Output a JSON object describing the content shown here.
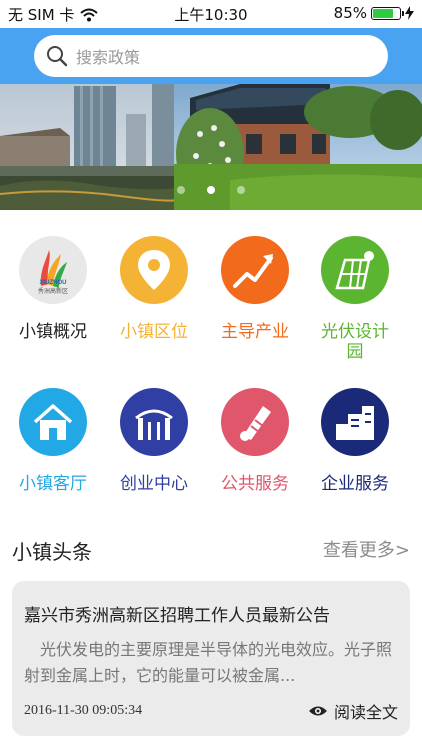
{
  "status_bar": {
    "carrier": "无 SIM 卡",
    "time": "上午10:30",
    "battery_percent": "85%",
    "battery_level": 0.85
  },
  "search": {
    "placeholder": "搜索政策"
  },
  "banner": {
    "slide_count": 3,
    "active_slide": 1
  },
  "logo": {
    "text_top": "XIUZHOU",
    "text_bottom": "秀洲高新区"
  },
  "grid": [
    {
      "label": "小镇概况",
      "color": "#222222",
      "icon": "logo-icon"
    },
    {
      "label": "小镇区位",
      "color": "#f5b335",
      "icon": "location-pin-icon"
    },
    {
      "label": "主导产业",
      "color": "#f26a1b",
      "icon": "trend-chart-icon"
    },
    {
      "label": "光伏设计园",
      "color": "#5cb531",
      "icon": "solar-panel-icon"
    },
    {
      "label": "小镇客厅",
      "color": "#23a8e6",
      "icon": "house-icon"
    },
    {
      "label": "创业中心",
      "color": "#2f3fa3",
      "icon": "gate-icon"
    },
    {
      "label": "公共服务",
      "color": "#e0566b",
      "icon": "scroll-icon"
    },
    {
      "label": "企业服务",
      "color": "#1b2a78",
      "icon": "building-icon"
    }
  ],
  "news": {
    "section_title": "小镇头条",
    "more_label": "查看更多>",
    "item": {
      "headline": "嘉兴市秀洲高新区招聘工作人员最新公告",
      "summary": "光伏发电的主要原理是半导体的光电效应。光子照射到金属上时，它的能量可以被金属...",
      "date": "2016-11-30 09:05:34",
      "read_label": "阅读全文"
    }
  }
}
